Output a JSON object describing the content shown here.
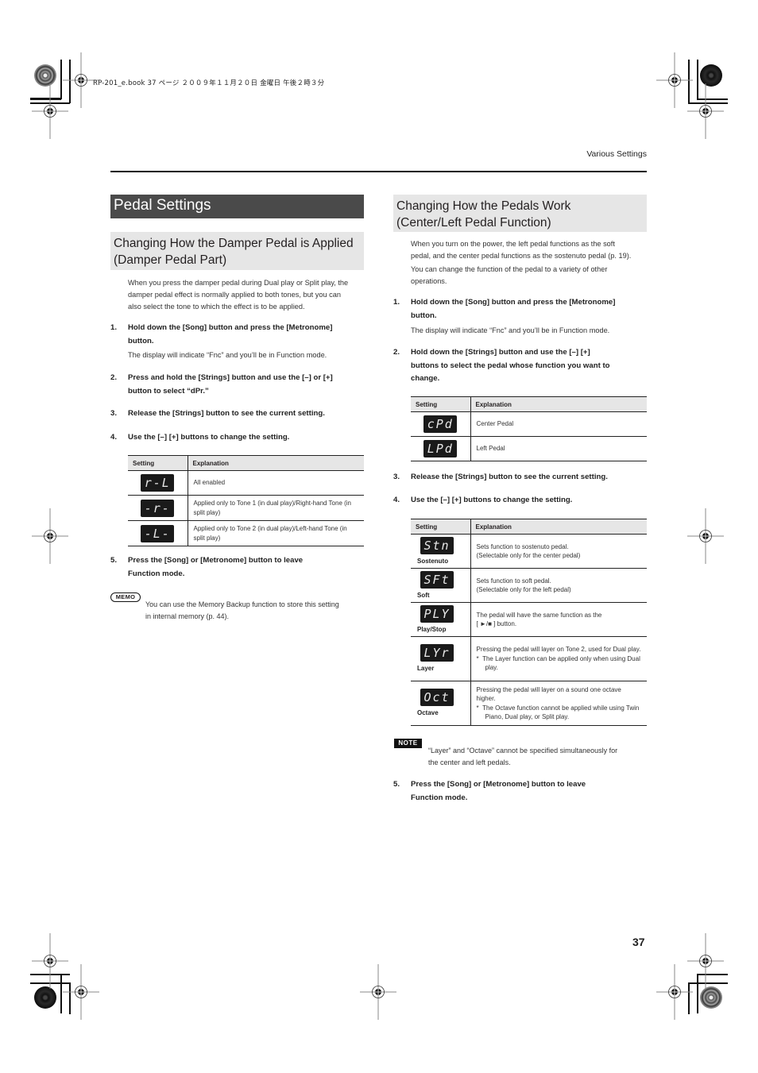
{
  "print_info": "RP-201_e.book  37 ページ  ２００９年１１月２０日  金曜日  午後２時３分",
  "running_head": "Various Settings",
  "page_number": "37",
  "left": {
    "section_title": "Pedal Settings",
    "subsection_title_line1": "Changing How the Damper Pedal is Applied",
    "subsection_title_line2": "(Damper Pedal Part)",
    "intro": [
      "When you press the damper pedal during Dual play or Split play, the",
      "damper pedal effect is normally applied to both tones, but you can",
      "also select the tone to which the effect is to be applied."
    ],
    "steps": [
      {
        "num": "1.",
        "lines": [
          "Hold down the [Song] button and press the [Metronome]",
          "button."
        ],
        "detail": "The display will indicate “Fnc” and you’ll be in Function mode."
      },
      {
        "num": "2.",
        "lines": [
          "Press and hold the [Strings] button and use the [–] or [+]",
          "button to select “dPr.”"
        ]
      },
      {
        "num": "3.",
        "lines": [
          "Release the [Strings] button to see the current setting."
        ]
      },
      {
        "num": "4.",
        "lines": [
          "Use the [–] [+] buttons to change the setting."
        ]
      },
      {
        "num": "5.",
        "lines": [
          "Press the [Song] or [Metronome] button to leave",
          "Function mode."
        ]
      }
    ],
    "table": {
      "headers": [
        "Setting",
        "Explanation"
      ],
      "rows": [
        {
          "display": "r-L",
          "explanation": "All enabled"
        },
        {
          "display": "-r-",
          "explanation": "Applied only to Tone 1 (in dual play)/Right-hand Tone (in split play)"
        },
        {
          "display": "-L-",
          "explanation": "Applied only to Tone 2 (in dual play)/Left-hand Tone (in split play)"
        }
      ]
    },
    "memo": {
      "icon_label": "MEMO",
      "lines": [
        "You can use the Memory Backup function to store this setting",
        "in internal memory (p. 44)."
      ]
    }
  },
  "right": {
    "subsection_title_line1": "Changing How the Pedals Work",
    "subsection_title_line2": "(Center/Left Pedal Function)",
    "intro": [
      "When you turn on the power, the left pedal functions as the soft",
      "pedal, and the center pedal functions as the sostenuto pedal (p. 19).",
      "You can change the function of the pedal to a variety of other",
      "operations."
    ],
    "steps": [
      {
        "num": "1.",
        "lines": [
          "Hold down the [Song] button and press the [Metronome]",
          "button."
        ],
        "detail": "The display will indicate “Fnc” and you’ll be in Function mode."
      },
      {
        "num": "2.",
        "lines": [
          "Hold down the [Strings] button and use the [–] [+]",
          "buttons to select the pedal whose function you want to",
          "change."
        ]
      },
      {
        "num": "3.",
        "lines": [
          "Release the [Strings] button to see the current setting."
        ]
      },
      {
        "num": "4.",
        "lines": [
          "Use the [–] [+] buttons to change the setting."
        ]
      },
      {
        "num": "5.",
        "lines": [
          "Press the [Song] or [Metronome] button to leave",
          "Function mode."
        ]
      }
    ],
    "pedal_table": {
      "headers": [
        "Setting",
        "Explanation"
      ],
      "rows": [
        {
          "display": "cPd",
          "explanation": "Center Pedal"
        },
        {
          "display": "LPd",
          "explanation": "Left Pedal"
        }
      ]
    },
    "function_table": {
      "headers": [
        "Setting",
        "Explanation"
      ],
      "rows": [
        {
          "display": "Stn",
          "label": "Sostenuto",
          "explanation": [
            "Sets function to sostenuto pedal.",
            "(Selectable only for the center pedal)"
          ]
        },
        {
          "display": "SFt",
          "label": "Soft",
          "explanation": [
            "Sets function to soft pedal.",
            "(Selectable only for the left pedal)"
          ]
        },
        {
          "display": "PLY",
          "label": "Play/Stop",
          "explanation": [
            "The pedal will have the same function as the",
            "[ ►/■ ] button."
          ]
        },
        {
          "display": "LYr",
          "label": "Layer",
          "explanation": [
            "Pressing the pedal will layer on Tone 2, used for Dual play."
          ],
          "note": "The Layer function can be applied only when using Dual play."
        },
        {
          "display": "Oct",
          "label": "Octave",
          "explanation": [
            "Pressing the pedal will layer on a sound one octave higher."
          ],
          "note": "The Octave function cannot be applied while using Twin Piano, Dual play, or Split play."
        }
      ]
    },
    "note": {
      "icon_label": "NOTE",
      "lines": [
        "“Layer” and “Octave” cannot be specified simultaneously for",
        "the center and left pedals."
      ]
    }
  }
}
